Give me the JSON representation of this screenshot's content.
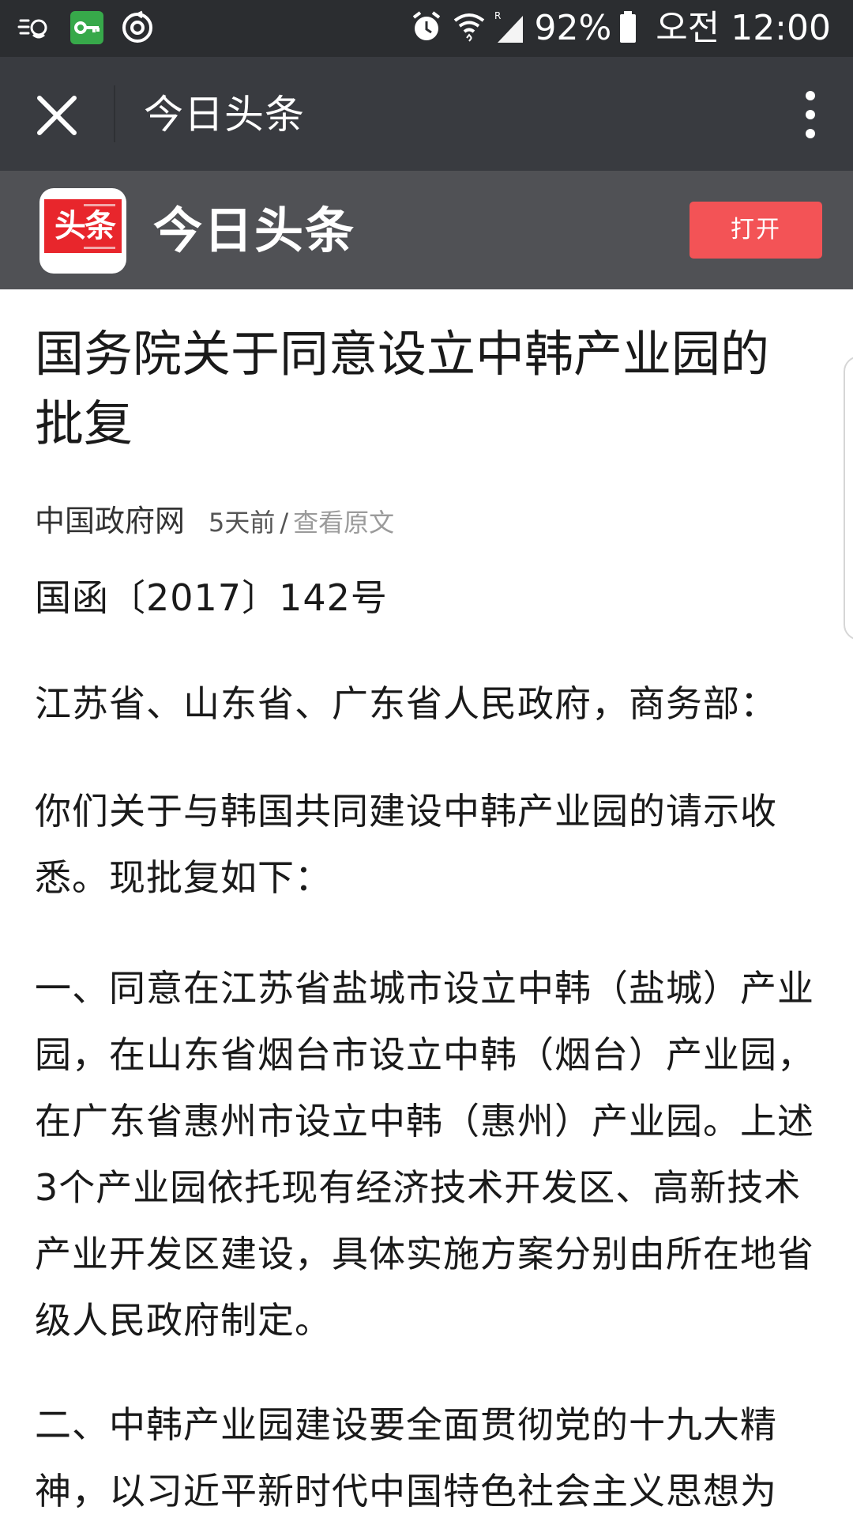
{
  "status_bar": {
    "left_icons": [
      "network-activity-icon",
      "vpn-key-icon",
      "sync-icon"
    ],
    "right_icons": [
      "alarm-icon",
      "wifi-icon",
      "signal-icon",
      "battery-icon"
    ],
    "battery": "92%",
    "time": "오전 12:00"
  },
  "app_bar": {
    "title": "今日头条",
    "close_icon": "close-icon",
    "menu_icon": "more-vert-icon"
  },
  "promo_banner": {
    "logo_text": "头条",
    "brand": "今日头条",
    "open_button": "打开",
    "colors": {
      "background": "#505155",
      "logo_red": "#e8262c",
      "button": "#f35356"
    }
  },
  "article": {
    "title": "国务院关于同意设立中韩产业园的批复",
    "meta": {
      "source": "中国政府网",
      "time": "5天前",
      "separator": "/",
      "link": "查看原文"
    },
    "paragraphs": {
      "doc_number": "国函〔2017〕142号",
      "addressees": "江苏省、山东省、广东省人民政府，商务部：",
      "intro": "你们关于与韩国共同建设中韩产业园的请示收悉。现批复如下：",
      "item1": "一、同意在江苏省盐城市设立中韩（盐城）产业园，在山东省烟台市设立中韩（烟台）产业园，在广东省惠州市设立中韩（惠州）产业园。上述3个产业园依托现有经济技术开发区、高新技术产业开发区建设，具体实施方案分别由所在地省级人民政府制定。",
      "item2": "二、中韩产业园建设要全面贯彻党的十九大精神，以习近平新时代中国特色社会主义思想为"
    }
  }
}
